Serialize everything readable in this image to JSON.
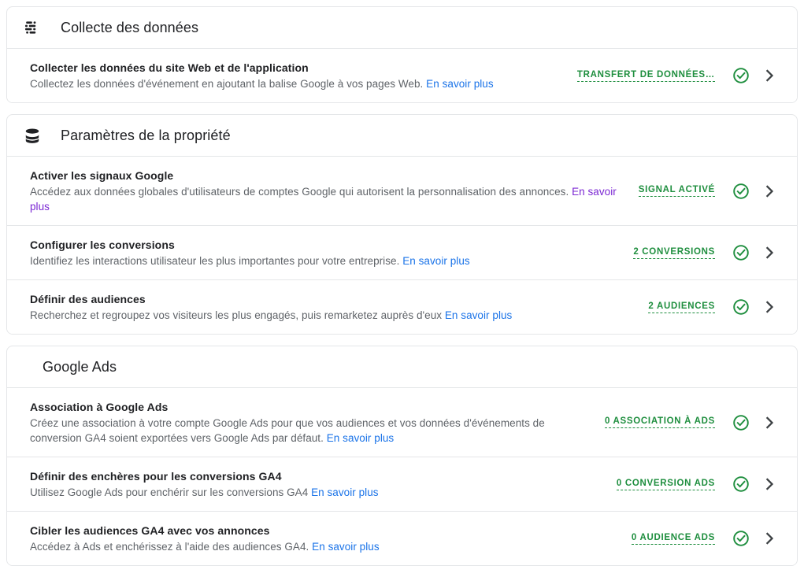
{
  "colors": {
    "accent_green": "#1e8e3e",
    "link_blue": "#1a73e8",
    "link_visited": "#7b27d3",
    "text_primary": "#202124",
    "text_secondary": "#5f6368",
    "border": "#e4e6e8"
  },
  "link_label": "En savoir plus",
  "sections": [
    {
      "id": "collecte-des-donnees",
      "icon": "data-collection-icon",
      "title": "Collecte des données",
      "rows": [
        {
          "id": "collecter-donnees-site-web-application",
          "title": "Collecter les données du site Web et de l'application",
          "desc_before": "Collectez les données d'événement en ajoutant la balise Google à vos pages Web.",
          "link": "En savoir plus",
          "link_visited": false,
          "desc_after": "",
          "badge": "TRANSFERT DE DONNÉES…",
          "status_icon": "check-circle-icon",
          "chevron": "chevron-right-icon"
        }
      ]
    },
    {
      "id": "parametres-de-la-propriete",
      "icon": "database-icon",
      "title": "Paramètres de la propriété",
      "rows": [
        {
          "id": "activer-signaux-google",
          "title": "Activer les signaux Google",
          "desc_before": "Accédez aux données globales d'utilisateurs de comptes Google qui autorisent la personnalisation des annonces.",
          "link": "En savoir plus",
          "link_visited": true,
          "desc_after": "",
          "badge": "SIGNAL ACTIVÉ",
          "status_icon": "check-circle-icon",
          "chevron": "chevron-right-icon"
        },
        {
          "id": "configurer-les-conversions",
          "title": "Configurer les conversions",
          "desc_before": "Identifiez les interactions utilisateur les plus importantes pour votre entreprise.",
          "link": "En savoir plus",
          "link_visited": false,
          "desc_after": "",
          "badge": "2 CONVERSIONS",
          "status_icon": "check-circle-icon",
          "chevron": "chevron-right-icon"
        },
        {
          "id": "definir-des-audiences",
          "title": "Définir des audiences",
          "desc_before": "Recherchez et regroupez vos visiteurs les plus engagés, puis remarketez auprès d'eux",
          "link": "En savoir plus",
          "link_visited": false,
          "desc_after": "",
          "badge": "2 AUDIENCES",
          "status_icon": "check-circle-icon",
          "chevron": "chevron-right-icon"
        }
      ]
    },
    {
      "id": "google-ads",
      "icon": "",
      "title": "Google Ads",
      "rows": [
        {
          "id": "association-a-google-ads",
          "title": "Association à Google Ads",
          "desc_before": "Créez une association à votre compte Google Ads pour que vos audiences et vos données d'événements de conversion GA4 soient exportées vers Google Ads par défaut.",
          "link": "En savoir plus",
          "link_visited": false,
          "desc_after": "",
          "badge": "0 ASSOCIATION À ADS",
          "status_icon": "check-circle-icon",
          "chevron": "chevron-right-icon"
        },
        {
          "id": "definir-encheres-conversions-ga4",
          "title": "Définir des enchères pour les conversions GA4",
          "desc_before": "Utilisez Google Ads pour enchérir sur les conversions GA4",
          "link": "En savoir plus",
          "link_visited": false,
          "desc_after": "",
          "badge": "0 CONVERSION ADS",
          "status_icon": "check-circle-icon",
          "chevron": "chevron-right-icon"
        },
        {
          "id": "cibler-audiences-ga4",
          "title": "Cibler les audiences GA4 avec vos annonces",
          "desc_before": "Accédez à Ads et enchérissez à l'aide des audiences GA4.",
          "link": "En savoir plus",
          "link_visited": false,
          "desc_after": "",
          "badge": "0 AUDIENCE ADS",
          "status_icon": "check-circle-icon",
          "chevron": "chevron-right-icon"
        }
      ]
    }
  ]
}
